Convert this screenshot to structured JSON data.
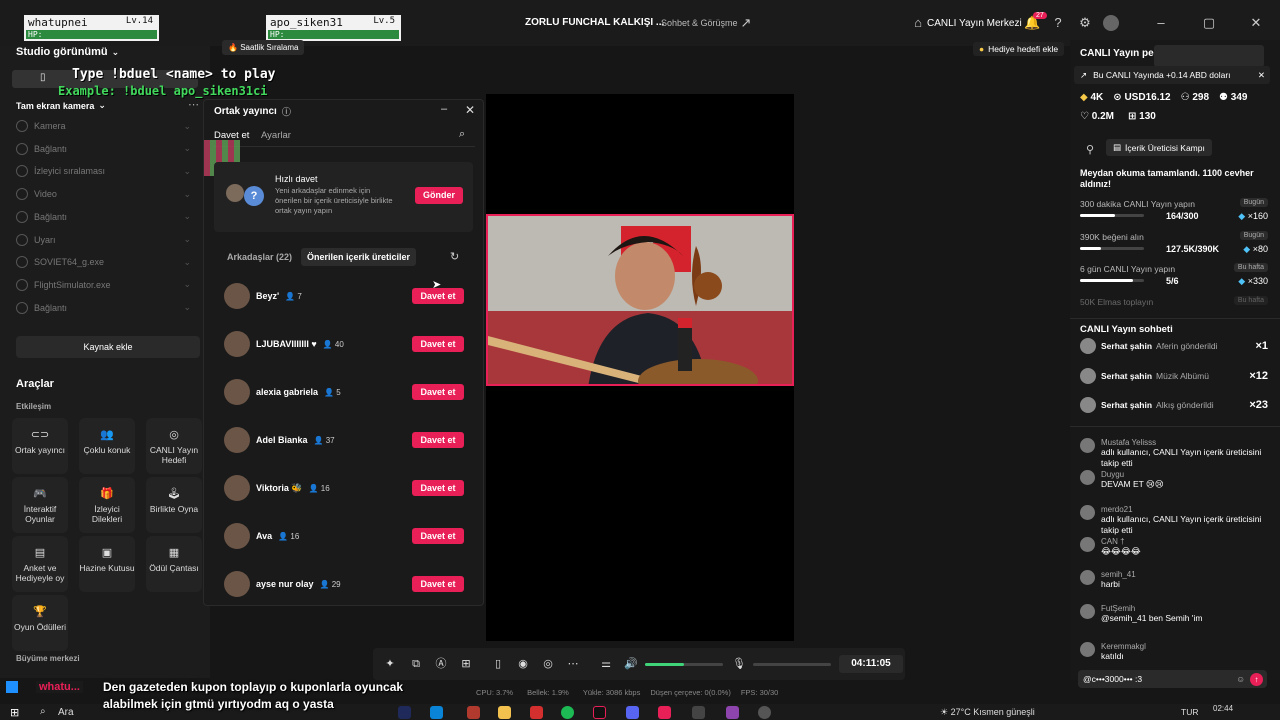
{
  "titlebar": {
    "player1": {
      "name": "whatupnei",
      "level": "Lv.14",
      "hp": "HP:"
    },
    "player2": {
      "name": "apo_siken31",
      "level": "Lv.5",
      "hp": "HP:"
    },
    "title": "ZORLU FUNCHAL KALKIŞI ...",
    "subtitle": "Sohbet & Görüşme",
    "live_center": "CANLI Yayın Merkezi",
    "notif_count": "27"
  },
  "left": {
    "studio_view": "Studio görünümü",
    "fullscreen_camera": "Tam ekran kamera",
    "hourly_ranking": "Saatlik Sıralama",
    "sources": [
      "Kamera",
      "Bağlantı",
      "İzleyici sıralaması",
      "Video",
      "Bağlantı",
      "Uyarı",
      "SOVIET64_g.exe",
      "FlightSimulator.exe",
      "Bağlantı"
    ],
    "add_source": "Kaynak ekle",
    "tools_title": "Araçlar",
    "engagement": "Etkileşim",
    "tools": [
      "Ortak yayıncı",
      "Çoklu konuk",
      "CANLI Yayın Hedefi",
      "İnteraktif Oyunlar",
      "İzleyici Dilekleri",
      "Birlikte Oyna",
      "Anket ve Hediyeyle oy",
      "Hazine Kutusu",
      "Ödül Çantası",
      "Oyun Ödülleri"
    ],
    "growth_center": "Büyüme merkezi"
  },
  "game_overlay": {
    "line1": "Type !bduel <name> to play",
    "line2": "Example: !bduel apo_siken31ci"
  },
  "panel": {
    "title": "Ortak yayıncı",
    "tab_invite": "Davet et",
    "tab_settings": "Ayarlar",
    "quick_invite_title": "Hızlı davet",
    "quick_invite_desc": "Yeni arkadaşlar edinmek için önerilen bir içerik üreticisiyle birlikte ortak yayın yapın",
    "send": "Gönder",
    "tab_friends": "Arkadaşlar (22)",
    "tab_suggested": "Önerilen içerik üreticiler",
    "invite_label": "Davet et",
    "friends": [
      {
        "name": "Beyz'",
        "count": "7"
      },
      {
        "name": "LJUBAVIIIIIII ♥",
        "count": "40"
      },
      {
        "name": "alexia gabriela",
        "count": "5"
      },
      {
        "name": "Adel Bianka",
        "count": "37"
      },
      {
        "name": "Viktoria 🐝",
        "count": "16"
      },
      {
        "name": "Ava",
        "count": "16"
      },
      {
        "name": "ayse nur olay",
        "count": "29"
      }
    ]
  },
  "preview": {
    "gift_goal": "Hediye hedefi ekle"
  },
  "controls": {
    "timer": "04:11:05",
    "volume_level": 0.5
  },
  "statusbar": {
    "cpu": "CPU: 3.7%",
    "memory": "Bellek: 1.9%",
    "upload": "Yükle: 3086 kbps",
    "dropped": "Düşen çerçeve: 0(0.0%)",
    "fps": "FPS: 30/30"
  },
  "right": {
    "header": "CANLI Yayın pe",
    "notice": "Bu CANLI Yayında +0.14 ABD doları",
    "stats": {
      "diamonds": "4K",
      "usd": "USD16.12",
      "viewers": "298",
      "people": "349",
      "likes": "0.2M",
      "gifts": "130"
    },
    "camp": "İçerik Üreticisi Kampı",
    "reward_msg": "Meydan okuma tamamlandı. 1100 cevher aldınız!",
    "tasks": [
      {
        "name": "300 dakika CANLI Yayın yapın",
        "badge": "Bugün",
        "progress": "164/300",
        "reward": "×160",
        "ratio": 0.55
      },
      {
        "name": "390K beğeni alın",
        "badge": "Bugün",
        "progress": "127.5K/390K",
        "reward": "×80",
        "ratio": 0.33
      },
      {
        "name": "6 gün CANLI Yayın yapın",
        "badge": "Bu hafta",
        "progress": "5/6",
        "reward": "×330",
        "ratio": 0.83
      },
      {
        "name": "50K Elmas toplayın",
        "badge": "Bu hafta"
      }
    ],
    "chat_title": "CANLI Yayın sohbeti",
    "gifts_list": [
      {
        "user": "Serhat şahin",
        "gift": "Aferin gönderildi",
        "x": "×1"
      },
      {
        "user": "Serhat şahin",
        "gift": "Müzik Albümü",
        "x": "×12"
      },
      {
        "user": "Serhat şahin",
        "gift": "Alkış gönderildi",
        "x": "×23"
      }
    ],
    "messages": [
      {
        "user": "Mustafa Yelisss",
        "text": "adlı kullanıcı, CANLI Yayın içerik üreticisini takip etti"
      },
      {
        "user": "Duygu",
        "text": "DEVAM ET 😢😢"
      },
      {
        "user": "merdo21",
        "text": "adlı kullanıcı, CANLI Yayın içerik üreticisini takip etti"
      },
      {
        "user": "CAN †",
        "text": "😂😂😂😂"
      },
      {
        "user": "semih_41",
        "text": "harbi"
      },
      {
        "user": "FutŞemih",
        "text": "@semih_41 ben Semih 'im"
      },
      {
        "user": "Keremmakgl",
        "text": "katıldı"
      }
    ],
    "input_value": "@c•••3000••• :3"
  },
  "subtitle": {
    "username": "whatu...",
    "line1": "Den gazeteden kupon toplayıp o kuponlarla oyuncak",
    "line2": "alabilmek için gtmü yırtıyodm aq o yasta"
  },
  "taskbar": {
    "search": "Ara",
    "weather": "27°C  Kısmen güneşli",
    "lang": "TUR",
    "time": "02:44"
  },
  "colors": {
    "accent": "#e91f57",
    "bg": "#161616"
  }
}
